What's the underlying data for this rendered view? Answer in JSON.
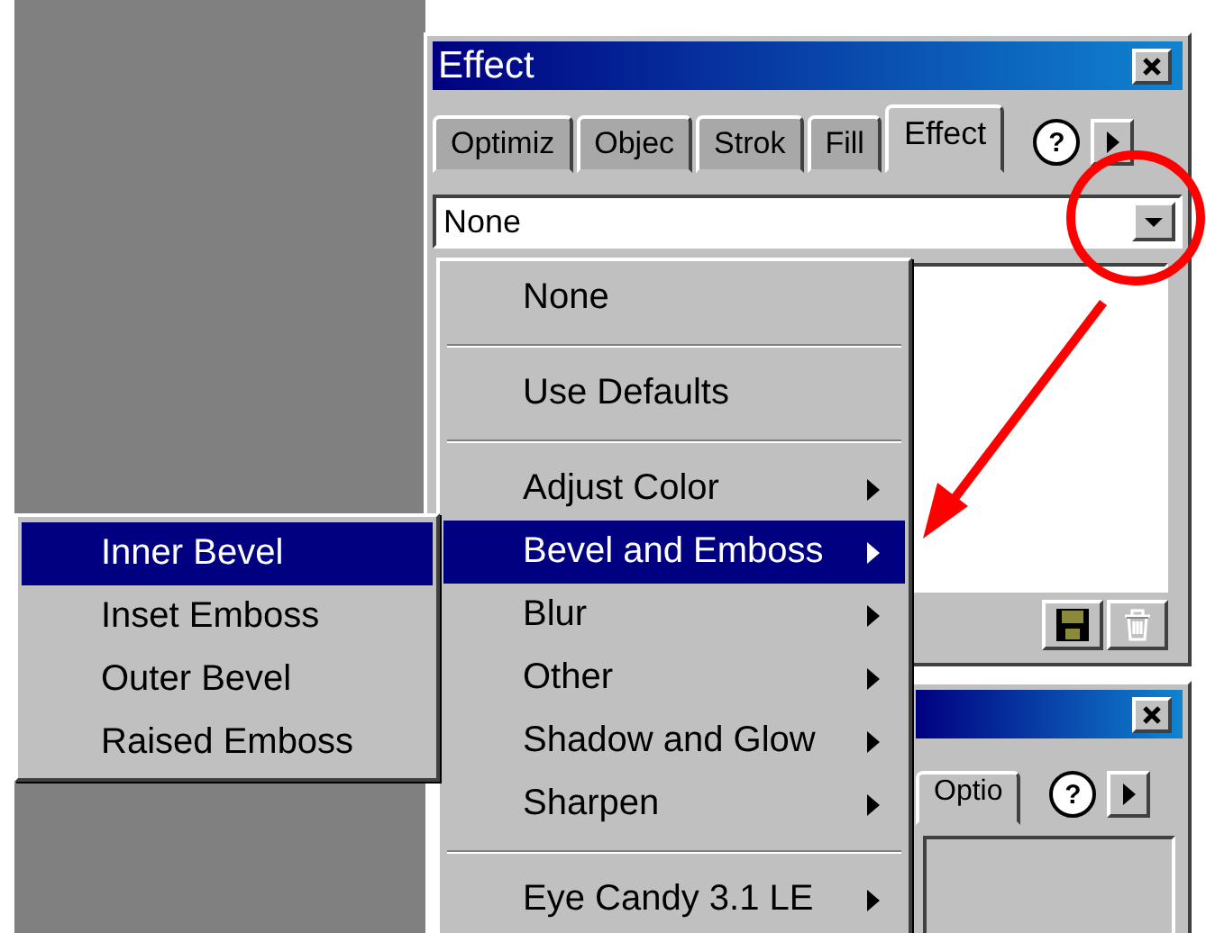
{
  "effect_panel": {
    "title": "Effect",
    "tabs": [
      {
        "label": "Optimiz",
        "selected": false
      },
      {
        "label": "Objec",
        "selected": false
      },
      {
        "label": "Strok",
        "selected": false
      },
      {
        "label": "Fill",
        "selected": false
      },
      {
        "label": "Effect",
        "selected": true
      }
    ],
    "help": "?",
    "dropdown": {
      "value": "None"
    },
    "save_disabled": false,
    "delete_disabled": true
  },
  "effect_menu": [
    {
      "kind": "item",
      "label": "None",
      "submenu": false,
      "selected": false
    },
    {
      "kind": "separator"
    },
    {
      "kind": "item",
      "label": "Use Defaults",
      "submenu": false,
      "selected": false
    },
    {
      "kind": "separator"
    },
    {
      "kind": "item",
      "label": "Adjust Color",
      "submenu": true,
      "selected": false
    },
    {
      "kind": "item",
      "label": "Bevel and Emboss",
      "submenu": true,
      "selected": true
    },
    {
      "kind": "item",
      "label": "Blur",
      "submenu": true,
      "selected": false
    },
    {
      "kind": "item",
      "label": "Other",
      "submenu": true,
      "selected": false
    },
    {
      "kind": "item",
      "label": "Shadow and Glow",
      "submenu": true,
      "selected": false
    },
    {
      "kind": "item",
      "label": "Sharpen",
      "submenu": true,
      "selected": false
    },
    {
      "kind": "separator"
    },
    {
      "kind": "item",
      "label": "Eye Candy 3.1 LE",
      "submenu": true,
      "selected": false
    }
  ],
  "submenu": [
    {
      "label": "Inner Bevel",
      "selected": true
    },
    {
      "label": "Inset Emboss",
      "selected": false
    },
    {
      "label": "Outer Bevel",
      "selected": false
    },
    {
      "label": "Raised Emboss",
      "selected": false
    }
  ],
  "second_panel": {
    "tabs": [
      {
        "label": "Optio",
        "selected": true
      }
    ],
    "help": "?"
  }
}
